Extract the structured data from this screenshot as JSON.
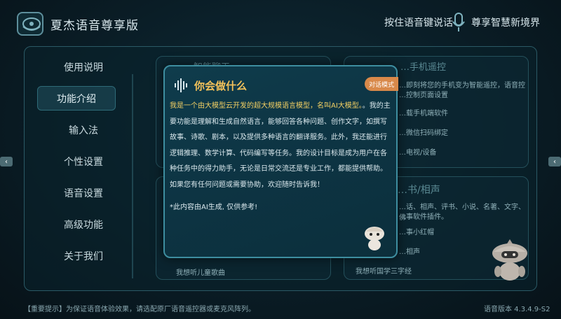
{
  "app": {
    "title": "夏杰语音尊享版",
    "voice_hint": "按住语音键说话",
    "slogan": "尊享智慧新境界"
  },
  "menu": {
    "items": [
      {
        "label": "使用说明"
      },
      {
        "label": "功能介绍"
      },
      {
        "label": "输入法"
      },
      {
        "label": "个性设置"
      },
      {
        "label": "语音设置"
      },
      {
        "label": "高级功能"
      },
      {
        "label": "关于我们"
      }
    ]
  },
  "cards": {
    "left_top_head": "…智能聊天",
    "left_bottom_text": "我想听儿童歌曲",
    "right_top_head": "…手机遥控",
    "right_top_desc_1": "…即刻将您的手机变为智能遥控，语音控",
    "right_top_desc_2": "…控制页面设置",
    "right_top_item_1": "…载手机端软件",
    "right_top_item_2": "…微信扫码绑定",
    "right_top_item_3": "…电视/设备",
    "right_bottom_head": "…书/相声",
    "right_bottom_desc_1": "…话、相声、评书、小说、名著、文字、佛",
    "right_bottom_desc_2": "…事软件插件。",
    "right_bottom_item_1": "…事小红帽",
    "right_bottom_item_2": "…相声",
    "right_bottom_item_3": "我想听国学三字经"
  },
  "dialog": {
    "title": "你会做什么",
    "mode_badge": "对话模式",
    "intro_highlight": "我是一个由大模型云开发的超大规模语言模型，名叫AI大模型。",
    "intro_rest": "。我的主要功能是理解和生成自然语言，能够回答各种问题、创作文字，如撰写故事、诗歌、剧本，以及提供多种语言的翻译服务。此外，我还能进行逻辑推理、数学计算、代码编写等任务。我的设计目标是成为用户在各种任务中的得力助手，无论是日常交流还是专业工作，都能提供帮助。如果您有任何问题或需要协助，欢迎随时告诉我！",
    "note": "*此内容由AI生成, 仅供参考!"
  },
  "footer": {
    "tip": "【重要提示】为保证语音体验效果，请选配原厂语音遥控器或麦克风阵列。",
    "version": "语音版本 4.3.4.9-S2"
  }
}
